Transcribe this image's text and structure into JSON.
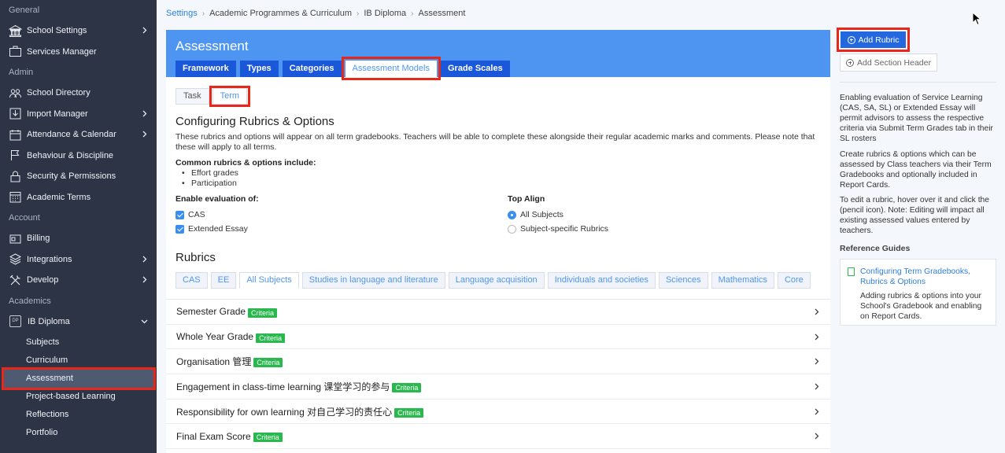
{
  "sidebar": {
    "sections": [
      {
        "label": "General",
        "items": [
          {
            "label": "School Settings",
            "icon": "bank-icon",
            "chevron": true
          },
          {
            "label": "Services Manager",
            "icon": "briefcase-icon",
            "chevron": false
          }
        ]
      },
      {
        "label": "Admin",
        "items": [
          {
            "label": "School Directory",
            "icon": "people-icon",
            "chevron": false
          },
          {
            "label": "Import Manager",
            "icon": "import-icon",
            "chevron": true
          },
          {
            "label": "Attendance & Calendar",
            "icon": "calendar-icon",
            "chevron": true
          },
          {
            "label": "Behaviour & Discipline",
            "icon": "flag-icon",
            "chevron": false
          },
          {
            "label": "Security & Permissions",
            "icon": "lock-icon",
            "chevron": false
          },
          {
            "label": "Academic Terms",
            "icon": "grid-calendar-icon",
            "chevron": false
          }
        ]
      },
      {
        "label": "Account",
        "items": [
          {
            "label": "Billing",
            "icon": "billing-icon",
            "chevron": false
          },
          {
            "label": "Integrations",
            "icon": "layers-icon",
            "chevron": true
          },
          {
            "label": "Develop",
            "icon": "tools-icon",
            "chevron": true
          }
        ]
      },
      {
        "label": "Academics",
        "items": [
          {
            "label": "IB Diploma",
            "icon": "dp-icon",
            "icon_text": "DP",
            "chevron": true,
            "expanded": true
          }
        ]
      }
    ],
    "sub_items": [
      "Subjects",
      "Curriculum",
      "Assessment",
      "Project-based Learning",
      "Reflections",
      "Portfolio"
    ],
    "active_sub_item": "Assessment"
  },
  "breadcrumb": [
    "Settings",
    "Academic Programmes & Curriculum",
    "IB Diploma",
    "Assessment"
  ],
  "card": {
    "title": "Assessment",
    "tabs": [
      "Framework",
      "Types",
      "Categories",
      "Assessment Models",
      "Grade Scales"
    ],
    "active_tab": "Assessment Models",
    "subtabs": [
      "Task",
      "Term"
    ],
    "active_subtab": "Term",
    "config_title": "Configuring Rubrics & Options",
    "config_desc": "These rubrics and options will appear on all term gradebooks. Teachers will be able to complete these alongside their regular academic marks and comments. Please note that these will apply to all terms.",
    "common_label": "Common rubrics & options include:",
    "common_items": [
      "Effort grades",
      "Participation"
    ],
    "enable_label": "Enable evaluation of:",
    "enable_options": [
      {
        "label": "CAS",
        "checked": true
      },
      {
        "label": "Extended Essay",
        "checked": true
      }
    ],
    "top_align_label": "Top Align",
    "top_align_options": [
      {
        "label": "All Subjects",
        "selected": true
      },
      {
        "label": "Subject-specific Rubrics",
        "selected": false
      }
    ],
    "rubrics_title": "Rubrics",
    "rubric_tabs": [
      "CAS",
      "EE",
      "All Subjects",
      "Studies in language and literature",
      "Language acquisition",
      "Individuals and societies",
      "Sciences",
      "Mathematics",
      "Core"
    ],
    "active_rubric_tab": "All Subjects",
    "rubric_rows": [
      {
        "label": "Semester Grade",
        "badge": "Criteria"
      },
      {
        "label": "Whole Year Grade",
        "badge": "Criteria"
      },
      {
        "label": "Organisation 管理",
        "badge": "Criteria"
      },
      {
        "label": "Engagement in class-time learning 课堂学习的参与",
        "badge": "Criteria"
      },
      {
        "label": "Responsibility for own learning 对自己学习的责任心",
        "badge": "Criteria"
      },
      {
        "label": "Final Exam Score",
        "badge": "Criteria"
      }
    ]
  },
  "right_panel": {
    "add_rubric_label": "Add Rubric",
    "add_section_label": "Add Section Header",
    "help_paragraphs": [
      "Enabling evaluation of Service Learning (CAS, SA, SL) or Extended Essay will permit advisors to assess the respective criteria via Submit Term Grades tab in their SL rosters",
      "Create rubrics & options which can be assessed by Class teachers via their Term Gradebooks and optionally included in Report Cards.",
      "To edit a rubric, hover over it and click the (pencil icon). Note: Editing will impact all existing assessed values entered by teachers."
    ],
    "reference_label": "Reference Guides",
    "reference_link": "Configuring Term Gradebooks, Rubrics & Options",
    "reference_desc": "Adding rubrics & options into your School's Gradebook and enabling on Report Cards."
  },
  "colors": {
    "sidebar_bg": "#2c3446",
    "header_blue": "#4e95f2",
    "tab_blue": "#1b58d9",
    "badge_green": "#29b84d",
    "highlight_red": "#e8271b"
  }
}
